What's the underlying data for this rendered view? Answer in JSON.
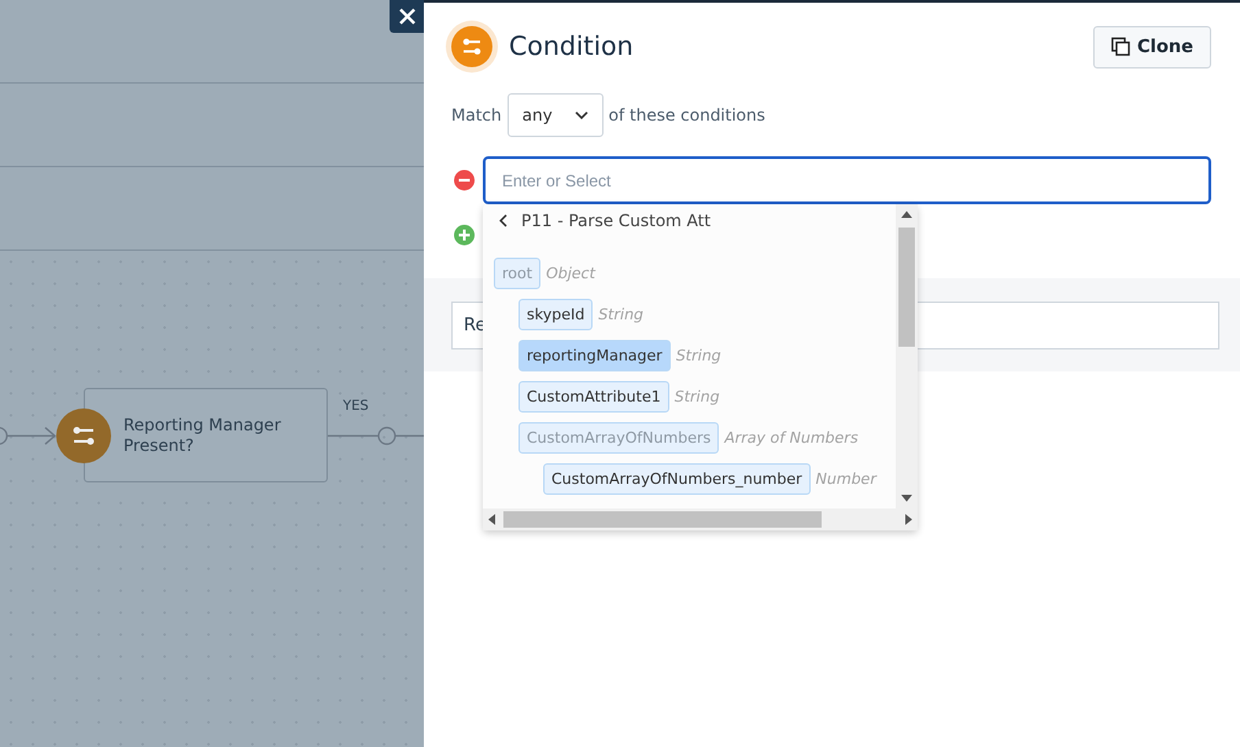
{
  "canvas": {
    "node": {
      "label": "Reporting Manager Present?"
    },
    "edge_label": "YES"
  },
  "panel": {
    "title": "Condition",
    "clone_button": "Clone",
    "match": {
      "prefix": "Match",
      "value": "any",
      "suffix": "of these conditions"
    },
    "condition_field": {
      "placeholder": "Enter or Select"
    },
    "second_field": {
      "value": "Re"
    },
    "dropdown": {
      "breadcrumb": "P11 - Parse Custom Att",
      "tree": [
        {
          "label": "root",
          "type": "Object",
          "selected": false,
          "disabled": true,
          "children": [
            {
              "label": "skypeId",
              "type": "String",
              "selected": false,
              "disabled": false
            },
            {
              "label": "reportingManager",
              "type": "String",
              "selected": true,
              "disabled": false
            },
            {
              "label": "CustomAttribute1",
              "type": "String",
              "selected": false,
              "disabled": false
            },
            {
              "label": "CustomArrayOfNumbers",
              "type": "Array of Numbers",
              "selected": false,
              "disabled": true,
              "children": [
                {
                  "label": "CustomArrayOfNumbers_number",
                  "type": "Number",
                  "selected": false,
                  "disabled": false
                }
              ]
            }
          ]
        }
      ]
    }
  }
}
